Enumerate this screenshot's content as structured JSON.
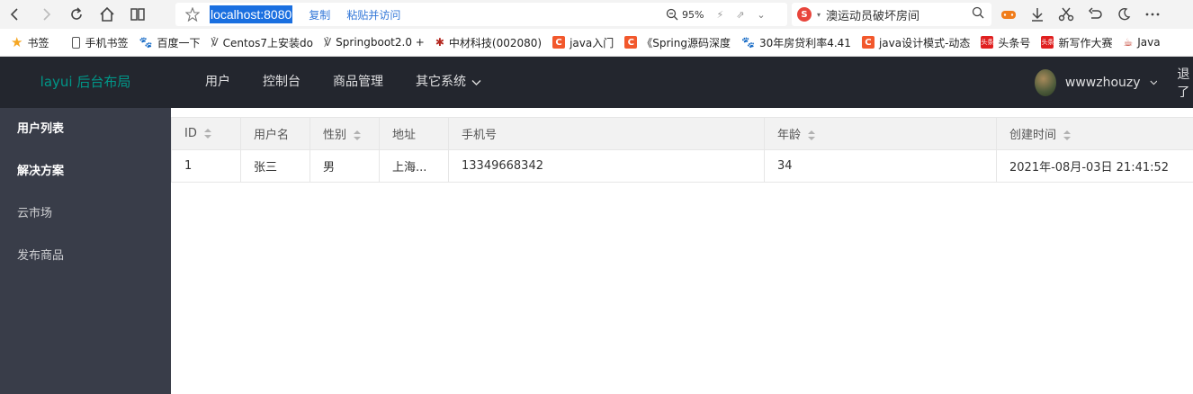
{
  "browser": {
    "url": "localhost:8080",
    "copy_label": "复制",
    "paste_visit_label": "粘贴并访问",
    "zoom": "95%",
    "search_text": "澳运动员破坏房间"
  },
  "bookmarks": [
    {
      "icon": "star-icon",
      "label": "书签"
    },
    {
      "icon": "phone-icon",
      "label": "手机书签"
    },
    {
      "icon": "baidu-paw-icon",
      "label": "百度一下"
    },
    {
      "icon": "leaf-icon",
      "label": "Centos7上安装do"
    },
    {
      "icon": "leaf-icon",
      "label": "Springboot2.0 +"
    },
    {
      "icon": "stock-icon",
      "label": "中材科技(002080)"
    },
    {
      "icon": "csdn-icon",
      "label": "java入门"
    },
    {
      "icon": "csdn-icon",
      "label": "《Spring源码深度"
    },
    {
      "icon": "baidu-paw-icon",
      "label": "30年房贷利率4.41"
    },
    {
      "icon": "csdn-icon",
      "label": "java设计模式-动态"
    },
    {
      "icon": "toutiao-icon",
      "label": "头条号"
    },
    {
      "icon": "toutiao-icon",
      "label": "新写作大赛"
    },
    {
      "icon": "java-icon",
      "label": "Java"
    }
  ],
  "app": {
    "logo": "layui 后台布局",
    "nav": [
      "用户",
      "控制台",
      "商品管理",
      "其它系统"
    ],
    "username": "wwwzhouzy",
    "logout": "退了"
  },
  "sidebar": {
    "items": [
      {
        "label": "用户列表",
        "active": true
      },
      {
        "label": "解决方案",
        "active": true
      },
      {
        "label": "云市场",
        "active": false
      },
      {
        "label": "发布商品",
        "active": false
      }
    ]
  },
  "table": {
    "columns": [
      {
        "label": "ID",
        "sortable": true
      },
      {
        "label": "用户名",
        "sortable": false
      },
      {
        "label": "性别",
        "sortable": true
      },
      {
        "label": "地址",
        "sortable": false
      },
      {
        "label": "手机号",
        "sortable": false
      },
      {
        "label": "年龄",
        "sortable": true
      },
      {
        "label": "创建时间",
        "sortable": true
      }
    ],
    "rows": [
      [
        "1",
        "张三",
        "男",
        "上海...",
        "13349668342",
        "34",
        "2021年-08月-03日 21:41:52"
      ]
    ]
  },
  "colors": {
    "header_bg": "#23262e",
    "sidebar_bg": "#393d49",
    "logo": "#009688",
    "url_highlight": "#1a6fe0"
  }
}
